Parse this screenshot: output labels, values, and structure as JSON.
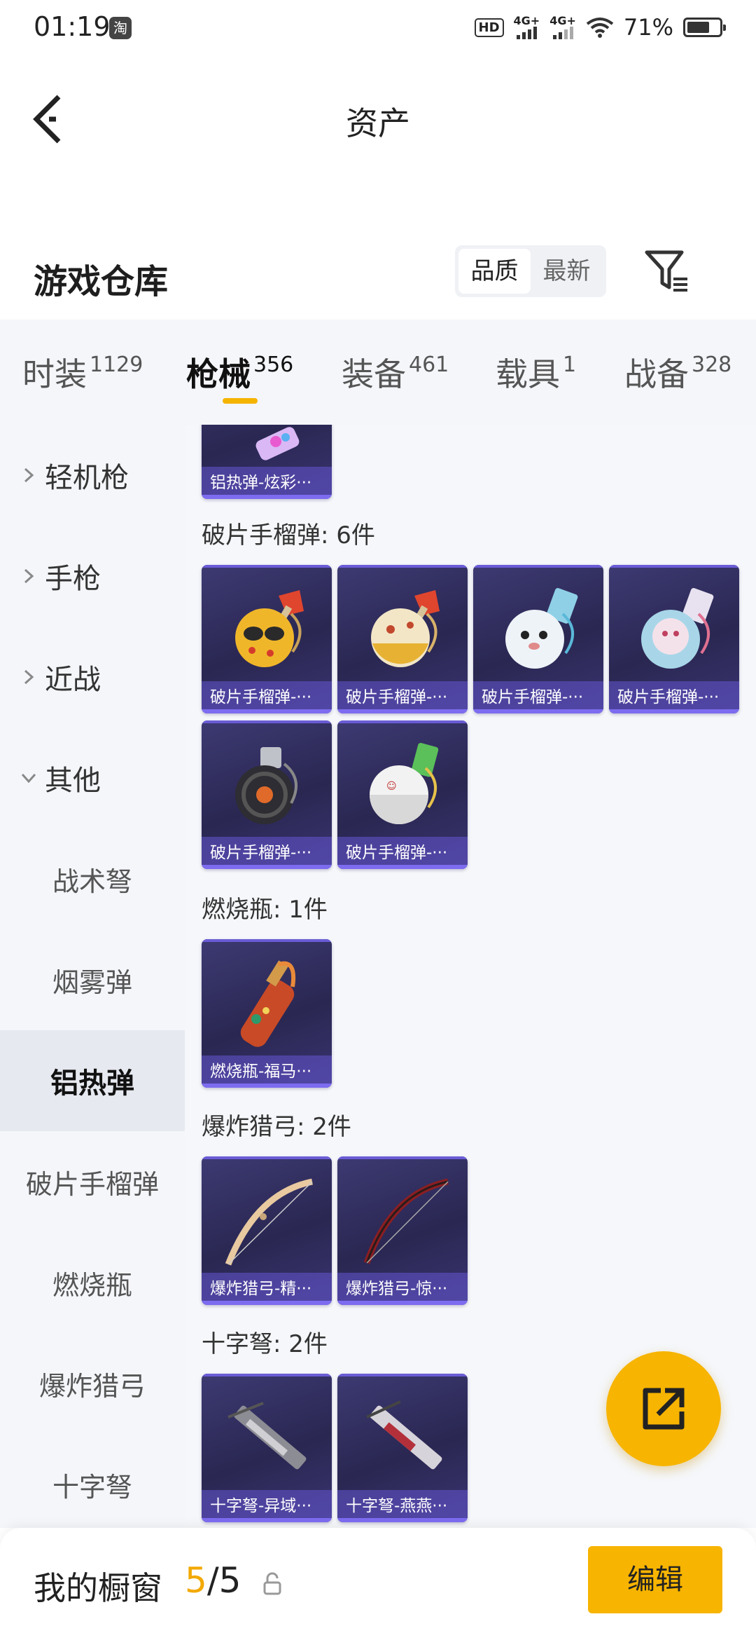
{
  "status_bar": {
    "time": "01:19",
    "app_badge": "淘",
    "hd_label": "HD",
    "net1": "4G+",
    "net2": "4G+",
    "battery_text": "71%",
    "battery_level": 0.71
  },
  "header": {
    "title": "资产"
  },
  "warehouse": {
    "title": "游戏仓库",
    "sort_options": [
      "品质",
      "最新"
    ],
    "sort_active": "品质"
  },
  "tabs": [
    {
      "label": "时装",
      "count": "1129"
    },
    {
      "label": "枪械",
      "count": "356"
    },
    {
      "label": "装备",
      "count": "461"
    },
    {
      "label": "载具",
      "count": "1"
    },
    {
      "label": "战备",
      "count": "328"
    }
  ],
  "active_tab": "枪械",
  "sidebar": {
    "categories": [
      "轻机枪",
      "手枪",
      "近战",
      "其他"
    ],
    "subitems": [
      "战术弩",
      "烟雾弹",
      "铝热弹",
      "破片手榴弹",
      "燃烧瓶",
      "爆炸猎弓",
      "十字弩"
    ],
    "active_subitem": "铝热弹"
  },
  "content": {
    "top_card": "铝热弹-炫彩···",
    "groups": [
      {
        "title": "破片手榴弹: 6件",
        "items": [
          "破片手榴弹-···",
          "破片手榴弹-···",
          "破片手榴弹-···",
          "破片手榴弹-···",
          "破片手榴弹-···",
          "破片手榴弹-···"
        ]
      },
      {
        "title": "燃烧瓶: 1件",
        "items": [
          "燃烧瓶-福马···"
        ]
      },
      {
        "title": "爆炸猎弓: 2件",
        "items": [
          "爆炸猎弓-精···",
          "爆炸猎弓-惊···"
        ]
      },
      {
        "title": "十字弩: 2件",
        "items": [
          "十字弩-异域···",
          "十字弩-燕燕···"
        ]
      }
    ]
  },
  "bottom_bar": {
    "label": "我的橱窗",
    "count_current": "5",
    "count_separator": "/",
    "count_total": "5",
    "edit_label": "编辑"
  },
  "colors": {
    "accent": "#f7b400",
    "card_bg": "#2f2b5e",
    "card_label": "#6455d2"
  }
}
